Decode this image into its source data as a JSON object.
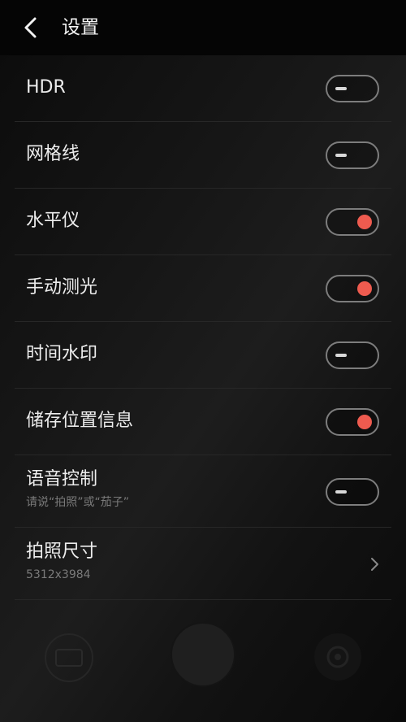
{
  "header": {
    "title": "设置"
  },
  "settings": [
    {
      "label": "HDR",
      "type": "toggle",
      "on": false
    },
    {
      "label": "网格线",
      "type": "toggle",
      "on": false
    },
    {
      "label": "水平仪",
      "type": "toggle",
      "on": true
    },
    {
      "label": "手动测光",
      "type": "toggle",
      "on": true
    },
    {
      "label": "时间水印",
      "type": "toggle",
      "on": false
    },
    {
      "label": "储存位置信息",
      "type": "toggle",
      "on": true
    },
    {
      "label": "语音控制",
      "sublabel": "请说“拍照”或“茄子”",
      "type": "toggle",
      "on": false
    },
    {
      "label": "拍照尺寸",
      "sublabel": "5312x3984",
      "type": "link"
    }
  ],
  "bottom_bar": {
    "mode_icon": "camera-mode-icon",
    "shutter": "shutter-button",
    "flip_icon": "camera-switch-icon"
  },
  "colors": {
    "accent": "#ee5b4f",
    "toggle_border": "#7d7d7d",
    "divider": "#272727",
    "secondary_text": "#7a7a7a"
  }
}
